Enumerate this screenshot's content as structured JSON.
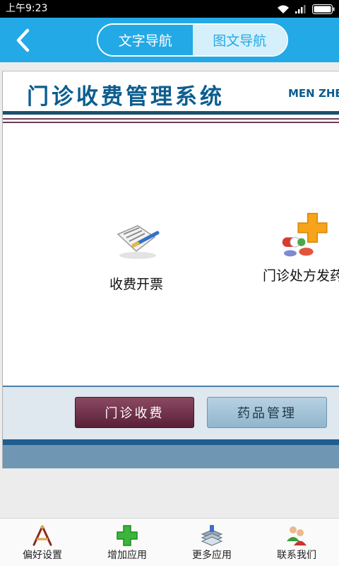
{
  "status_bar": {
    "time": "上午9:23"
  },
  "title_bar": {
    "segments": {
      "text_nav": "文字导航",
      "image_nav": "图文导航"
    }
  },
  "web": {
    "system_title": "门诊收费管理系统",
    "system_title_en": "MEN ZHE",
    "modules": [
      {
        "label": "收费开票",
        "icon": "invoice-icon"
      },
      {
        "label": "门诊处方发药",
        "icon": "pharmacy-icon"
      }
    ],
    "buttons": {
      "outpatient_fee": "门诊收费",
      "drug_management": "药品管理"
    }
  },
  "tab_bar": {
    "items": [
      {
        "label": "偏好设置",
        "icon": "preferences-icon"
      },
      {
        "label": "增加应用",
        "icon": "add-app-icon"
      },
      {
        "label": "更多应用",
        "icon": "more-apps-icon"
      },
      {
        "label": "联系我们",
        "icon": "contact-icon"
      }
    ]
  },
  "colors": {
    "accent": "#23a9e6",
    "title_blue": "#0c5d8f",
    "maroon": "#5a2038"
  }
}
